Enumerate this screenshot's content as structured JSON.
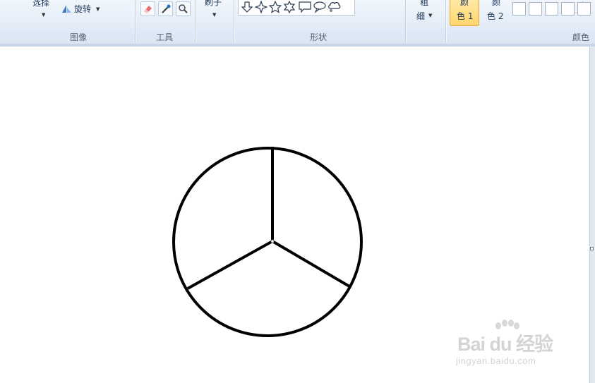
{
  "ribbon": {
    "image_group": {
      "select_label": "选择",
      "rotate_label": "旋转",
      "group_label": "图像"
    },
    "tools_group": {
      "group_label": "工具",
      "tools": [
        "eraser-icon",
        "color-picker-icon",
        "magnifier-icon"
      ]
    },
    "brushes_group": {
      "brush_label": "刷子"
    },
    "shapes_group": {
      "group_label": "形状",
      "shapes": [
        "down-arrow-shape",
        "four-point-star-shape",
        "five-point-star-shape",
        "six-point-star-shape",
        "rect-callout-shape",
        "oval-callout-shape",
        "cloud-callout-shape"
      ]
    },
    "size": {
      "label_top": "粗",
      "label_bottom": "细"
    },
    "colors_group": {
      "color1_top": "颜",
      "color1_bottom": "色 1",
      "color2_top": "颜",
      "color2_bottom": "色 2",
      "group_label": "颜色",
      "accent": "#ffd66b"
    }
  },
  "canvas": {
    "drawing": "circle divided into three sectors by lines from the center",
    "stroke_color": "#000000"
  },
  "watermark": {
    "main": "Bai du 经验",
    "sub": "jingyan.baidu.com"
  }
}
